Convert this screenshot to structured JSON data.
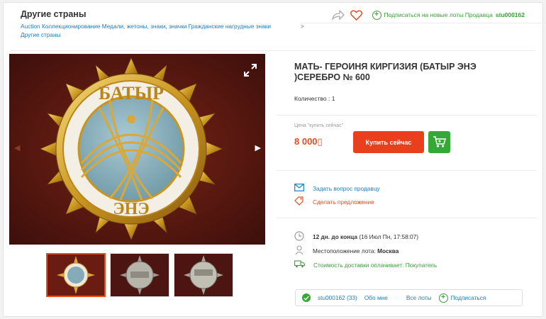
{
  "header": {
    "category_title": "Другие страны",
    "breadcrumbs": [
      "Auction",
      "Коллекционирование",
      "Медали, жетоны, знаки, значки",
      "Гражданские нагрудные знаки",
      "Другие страны"
    ],
    "subscribe_text": "Подписаться на новые лоты Продавца",
    "seller_name": "stu000162"
  },
  "lot": {
    "title": "МАТЬ- ГЕРОИНЯ КИРГИЗИЯ (БАТЫР ЭНЭ )СЕРЕБРО № 600",
    "quantity": "Количество : 1",
    "price_label": "Цена \"купить сейчас\"",
    "price": "8 000",
    "currency_glyph": "▯",
    "buy_label": "Купить сейчас",
    "medal_text_top": "БАТЫР",
    "medal_text_bottom": "ЭНЭ"
  },
  "actions": {
    "ask_seller": "Задать вопрос продавцу",
    "make_offer": "Сделать предложение"
  },
  "details": {
    "time_left_bold": "12 дн. до конца",
    "time_left_rest": "(16 Июл Пн, 17:58:07)",
    "location_label": "Местоположение лота:",
    "location_value": "Москва",
    "shipping": "Стоимость доставки оплачивает: Покупатель"
  },
  "seller_bar": {
    "name_rating": "stu000162 (33)",
    "about": "Обо мне",
    "all_lots": "Все лоты",
    "subscribe": "Подписаться"
  },
  "colors": {
    "accent_orange": "#e8401c",
    "accent_green": "#35a935",
    "link_blue": "#1b7fc3"
  },
  "icons": [
    "share-icon",
    "heart-icon",
    "plus-circle-icon",
    "expand-icon",
    "cart-icon",
    "mail-icon",
    "offer-icon",
    "clock-icon",
    "location-icon",
    "truck-icon",
    "check-icon"
  ]
}
